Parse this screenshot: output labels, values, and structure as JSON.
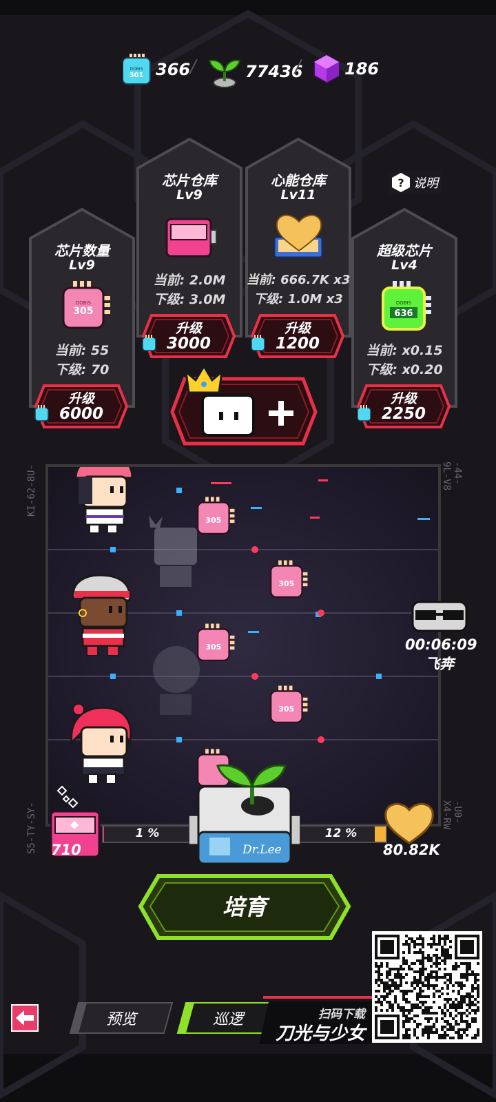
{
  "currency": {
    "chip_count": "366",
    "sprout_count": "77436",
    "cube_count": "186",
    "separator": "/"
  },
  "chip_icon_text": {
    "brand": "DOBIS",
    "code_301": "301",
    "code_305": "305",
    "code_636": "636"
  },
  "help": {
    "label": "说明"
  },
  "cards": {
    "chip_count": {
      "title": "芯片数量",
      "level": "Lv9",
      "current": "当前: 55",
      "next": "下级: 70",
      "button_label": "升级",
      "cost": "6000"
    },
    "chip_storage": {
      "title": "芯片仓库",
      "level": "Lv9",
      "current": "当前: 2.0M",
      "next": "下级: 3.0M",
      "button_label": "升级",
      "cost": "3000"
    },
    "heart_storage": {
      "title": "心能仓库",
      "level": "Lv11",
      "current": "当前: 666.7K x3",
      "next": "下级: 1.0M x3",
      "button_label": "升级",
      "cost": "1200"
    },
    "super_chip": {
      "title": "超级芯片",
      "level": "Lv4",
      "current": "当前: x0.15",
      "next": "下级: x0.20",
      "button_label": "升级",
      "cost": "2250"
    }
  },
  "field": {
    "left_codes": [
      "KI-62-8U-",
      "S5-TY-SY-"
    ],
    "right_codes": [
      "-44-9L-V8",
      "-U0-X4-RW"
    ]
  },
  "timer": {
    "time": "00:06:09",
    "label": "飞奔"
  },
  "bottom": {
    "chip_stock": "710",
    "chip_percent": "1 %",
    "heart_percent": "12 %",
    "heart_stock": "80.82K",
    "machine_label": "Dr.Lee",
    "grow_button": "培育"
  },
  "nav": {
    "preview": "预览",
    "patrol": "巡逻"
  },
  "promo": {
    "scan_text": "扫码下载",
    "game_title": "刀光与少女"
  },
  "colors": {
    "accent_red": "#e8304a",
    "accent_green": "#8ee02a",
    "chip_cyan": "#4fd8ef",
    "chip_pink": "#f486b4",
    "chip_green": "#5ef23a",
    "gold": "#f5b13a"
  }
}
